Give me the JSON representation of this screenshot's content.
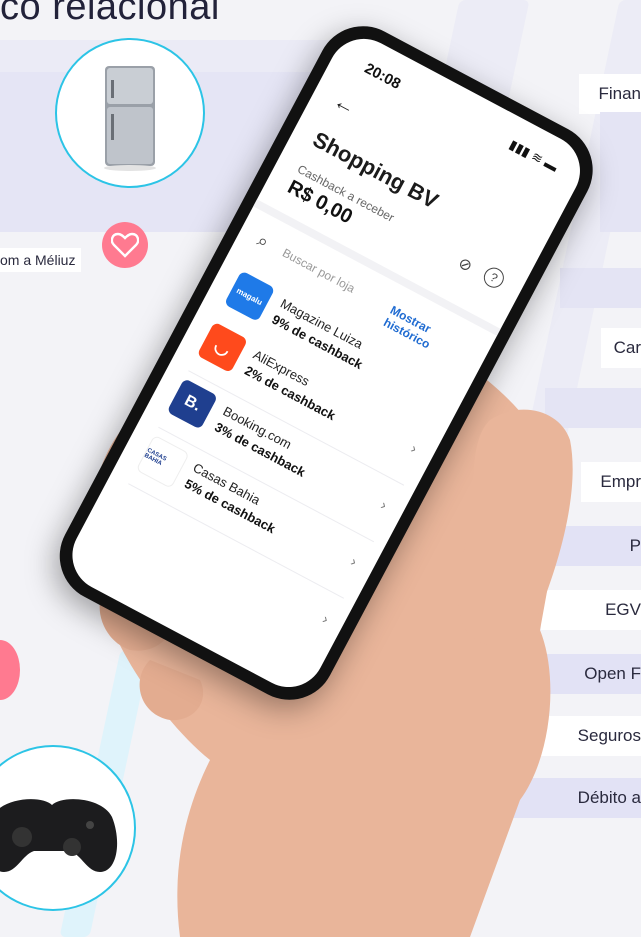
{
  "header": {
    "title": "co relacional"
  },
  "promo": {
    "meliuz_text": "om a Méliuz"
  },
  "right_menu": [
    {
      "label": "Finan"
    },
    {
      "label": "Car"
    },
    {
      "label": "Empr"
    },
    {
      "label": "P"
    },
    {
      "label": "EGV"
    },
    {
      "label": "Open F"
    },
    {
      "label": "Seguros"
    },
    {
      "label": "Débito a"
    }
  ],
  "phone": {
    "time": "20:08",
    "status_icons": "▮▮▮ ≋ ▬",
    "back_icon": "←",
    "title": "Shopping BV",
    "cashback_label": "Cashback a receber",
    "cashback_value": "R$ 0,00",
    "search_placeholder": "Buscar por loja",
    "show_history": "Mostrar histórico",
    "stores": [
      {
        "name": "Magazine Luiza",
        "cashback": "9% de cashback",
        "logo_text": "magalu",
        "color": "#1f7ae8"
      },
      {
        "name": "AliExpress",
        "cashback": "2% de cashback",
        "logo_text": "◡",
        "color": "#ff4a1c"
      },
      {
        "name": "Booking.com",
        "cashback": "3% de cashback",
        "logo_text": "B.",
        "color": "#1f3f8f"
      },
      {
        "name": "Casas Bahia",
        "cashback": "5% de cashback",
        "logo_text": "CASAS BAHIA",
        "color": "#ffffff"
      }
    ]
  },
  "colors": {
    "accent": "#2cc4e6",
    "brand_pink": "#ff7a90",
    "link_blue": "#1f6bd1"
  }
}
